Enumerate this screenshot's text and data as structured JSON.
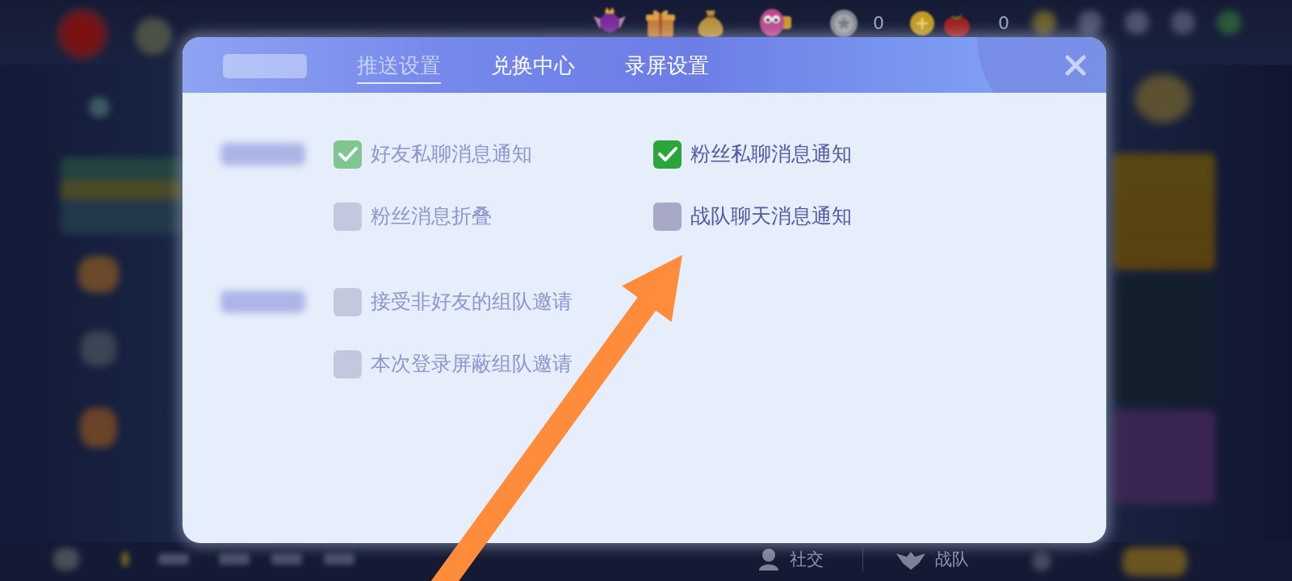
{
  "top_bar": {
    "counters": [
      {
        "value": "0"
      },
      {
        "value": "0"
      }
    ]
  },
  "dialog": {
    "tabs": [
      {
        "selected": false,
        "dimmed": true
      },
      {
        "label": "推送设置",
        "selected": true,
        "dimmed": true
      },
      {
        "label": "兑换中心",
        "selected": false,
        "dimmed": false
      },
      {
        "label": "录屏设置",
        "selected": false,
        "dimmed": false
      }
    ],
    "sections": [
      {
        "rows": [
          [
            {
              "label": "好友私聊消息通知",
              "checked": true,
              "dimmed": true
            },
            {
              "label": "粉丝私聊消息通知",
              "checked": true,
              "dimmed": false
            }
          ],
          [
            {
              "label": "粉丝消息折叠",
              "checked": false,
              "dimmed": true
            },
            {
              "label": "战队聊天消息通知",
              "checked": false,
              "dimmed": false
            }
          ]
        ]
      },
      {
        "rows": [
          [
            {
              "label": "接受非好友的组队邀请",
              "checked": false,
              "dimmed": true
            }
          ],
          [
            {
              "label": "本次登录屏蔽组队邀请",
              "checked": false,
              "dimmed": true
            }
          ]
        ]
      }
    ]
  },
  "bottom_bar": {
    "nav_items": [
      {
        "label": "社交"
      },
      {
        "label": "战队"
      }
    ]
  }
}
